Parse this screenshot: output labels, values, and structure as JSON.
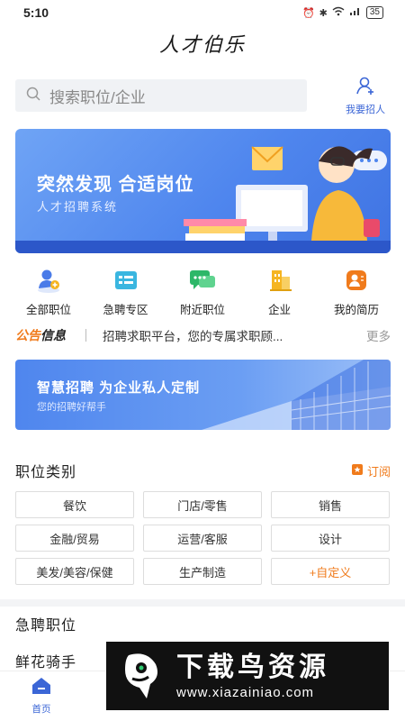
{
  "status_bar": {
    "time": "5:10",
    "battery": "35"
  },
  "app": {
    "title": "人才伯乐"
  },
  "search": {
    "placeholder": "搜索职位/企业"
  },
  "recruit": {
    "label": "我要招人"
  },
  "banner": {
    "title": "突然发现 合适岗位",
    "subtitle": "人才招聘系统"
  },
  "quick_nav": [
    {
      "label": "全部职位",
      "icon": "person-plus-icon",
      "color": "#4a7be8"
    },
    {
      "label": "急聘专区",
      "icon": "list-card-icon",
      "color": "#3ab6e0"
    },
    {
      "label": "附近职位",
      "icon": "chat-bubble-icon",
      "color": "#2db768"
    },
    {
      "label": "企业",
      "icon": "building-icon",
      "color": "#f5b521"
    },
    {
      "label": "我的简历",
      "icon": "resume-icon",
      "color": "#f07b1c"
    }
  ],
  "notice": {
    "tag_part1": "公告",
    "tag_part2": "信息",
    "text": "招聘求职平台，您的专属求职顾...",
    "more": "更多"
  },
  "promo": {
    "title": "智慧招聘 为企业私人定制",
    "subtitle": "您的招聘好帮手"
  },
  "categories": {
    "title": "职位类别",
    "subscribe": "订阅",
    "items": [
      "餐饮",
      "门店/零售",
      "销售",
      "金融/贸易",
      "运营/客服",
      "设计",
      "美发/美容/保健",
      "生产制造"
    ],
    "custom": "+自定义"
  },
  "urgent": {
    "title": "急聘职位",
    "first_job": "鲜花骑手"
  },
  "tabbar": {
    "home": "首页"
  },
  "watermark": {
    "title": "下载鸟资源",
    "url": "www.xiazainiao.com"
  },
  "colors": {
    "accent_blue": "#3b66d6",
    "accent_orange": "#f07b1c"
  }
}
